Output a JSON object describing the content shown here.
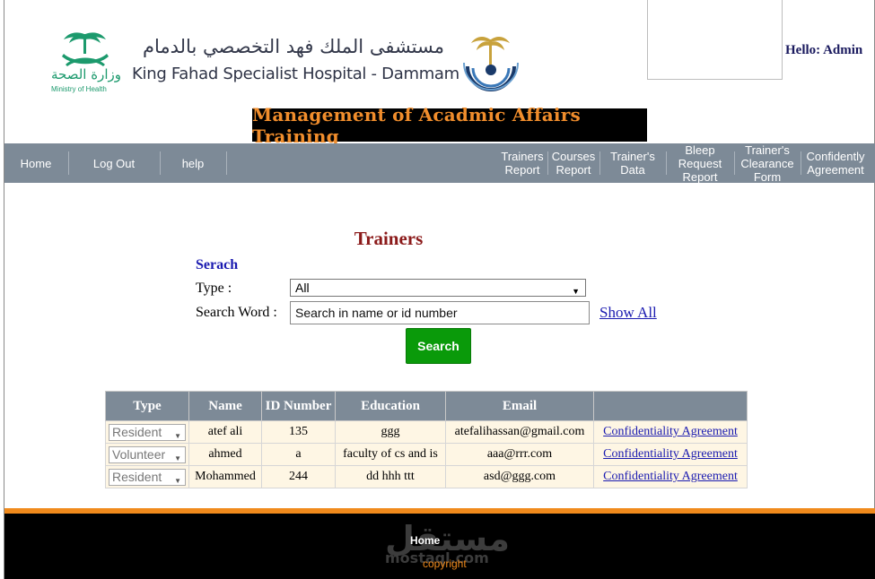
{
  "header": {
    "moh_name_ar": "وزارة الصحة",
    "moh_name_en": "Ministry of Health",
    "hospital_name_ar": "مستشفى الملك فهد التخصصي بالدمام",
    "hospital_name_en": "King Fahad Specialist Hospital - Dammam",
    "greeting": "Hello: Admin",
    "banner_title": "Management of Acadmic Affairs Training"
  },
  "nav": {
    "home": "Home",
    "logout": "Log Out",
    "help": "help",
    "trainers_report": [
      "Trainers",
      "Report"
    ],
    "courses_report": [
      "Courses",
      "Report"
    ],
    "trainers_data": [
      "Trainer's",
      "Data"
    ],
    "bleep_request": [
      "Bleep",
      "Request",
      "Report"
    ],
    "clearance_form": [
      "Trainer's",
      "Clearance",
      "Form"
    ],
    "confidently_agreement": [
      "Confidently",
      "Agreement"
    ]
  },
  "main": {
    "title": "Trainers",
    "search_heading": "Serach",
    "type_label": "Type :",
    "type_selected": "All",
    "search_word_label": "Search Word :",
    "search_placeholder": "Search in name or id number",
    "show_all": "Show All",
    "search_button": "Search"
  },
  "table": {
    "headers": {
      "type": "Type",
      "name": "Name",
      "id": "ID Number",
      "education": "Education",
      "email": "Email",
      "action": ""
    },
    "rows": [
      {
        "type": "Resident",
        "name": "atef ali",
        "id": "135",
        "education": "ggg",
        "email": "atefalihassan@gmail.com",
        "link": "Confidentiality Agreement"
      },
      {
        "type": "Volunteer",
        "name": "ahmed",
        "id": "a",
        "education": "faculty of cs and is",
        "email": "aaa@rrr.com",
        "link": "Confidentiality Agreement"
      },
      {
        "type": "Resident",
        "name": "Mohammed",
        "id": "244",
        "education": "dd hhh ttt",
        "email": "asd@ggg.com",
        "link": "Confidentiality Agreement"
      }
    ]
  },
  "footer": {
    "home": "Home",
    "copyright": "copyright",
    "watermark_ar": "مستقل",
    "watermark_en": "mostaql.com"
  },
  "colors": {
    "nav_bg": "#7d8a97",
    "banner_text": "#f08d2c",
    "title": "#8b1a1a",
    "link": "#1a1ab0",
    "search_button": "#0a9a0a",
    "row_bg": "#fef6e4",
    "footer_accent": "#f08a1c"
  }
}
